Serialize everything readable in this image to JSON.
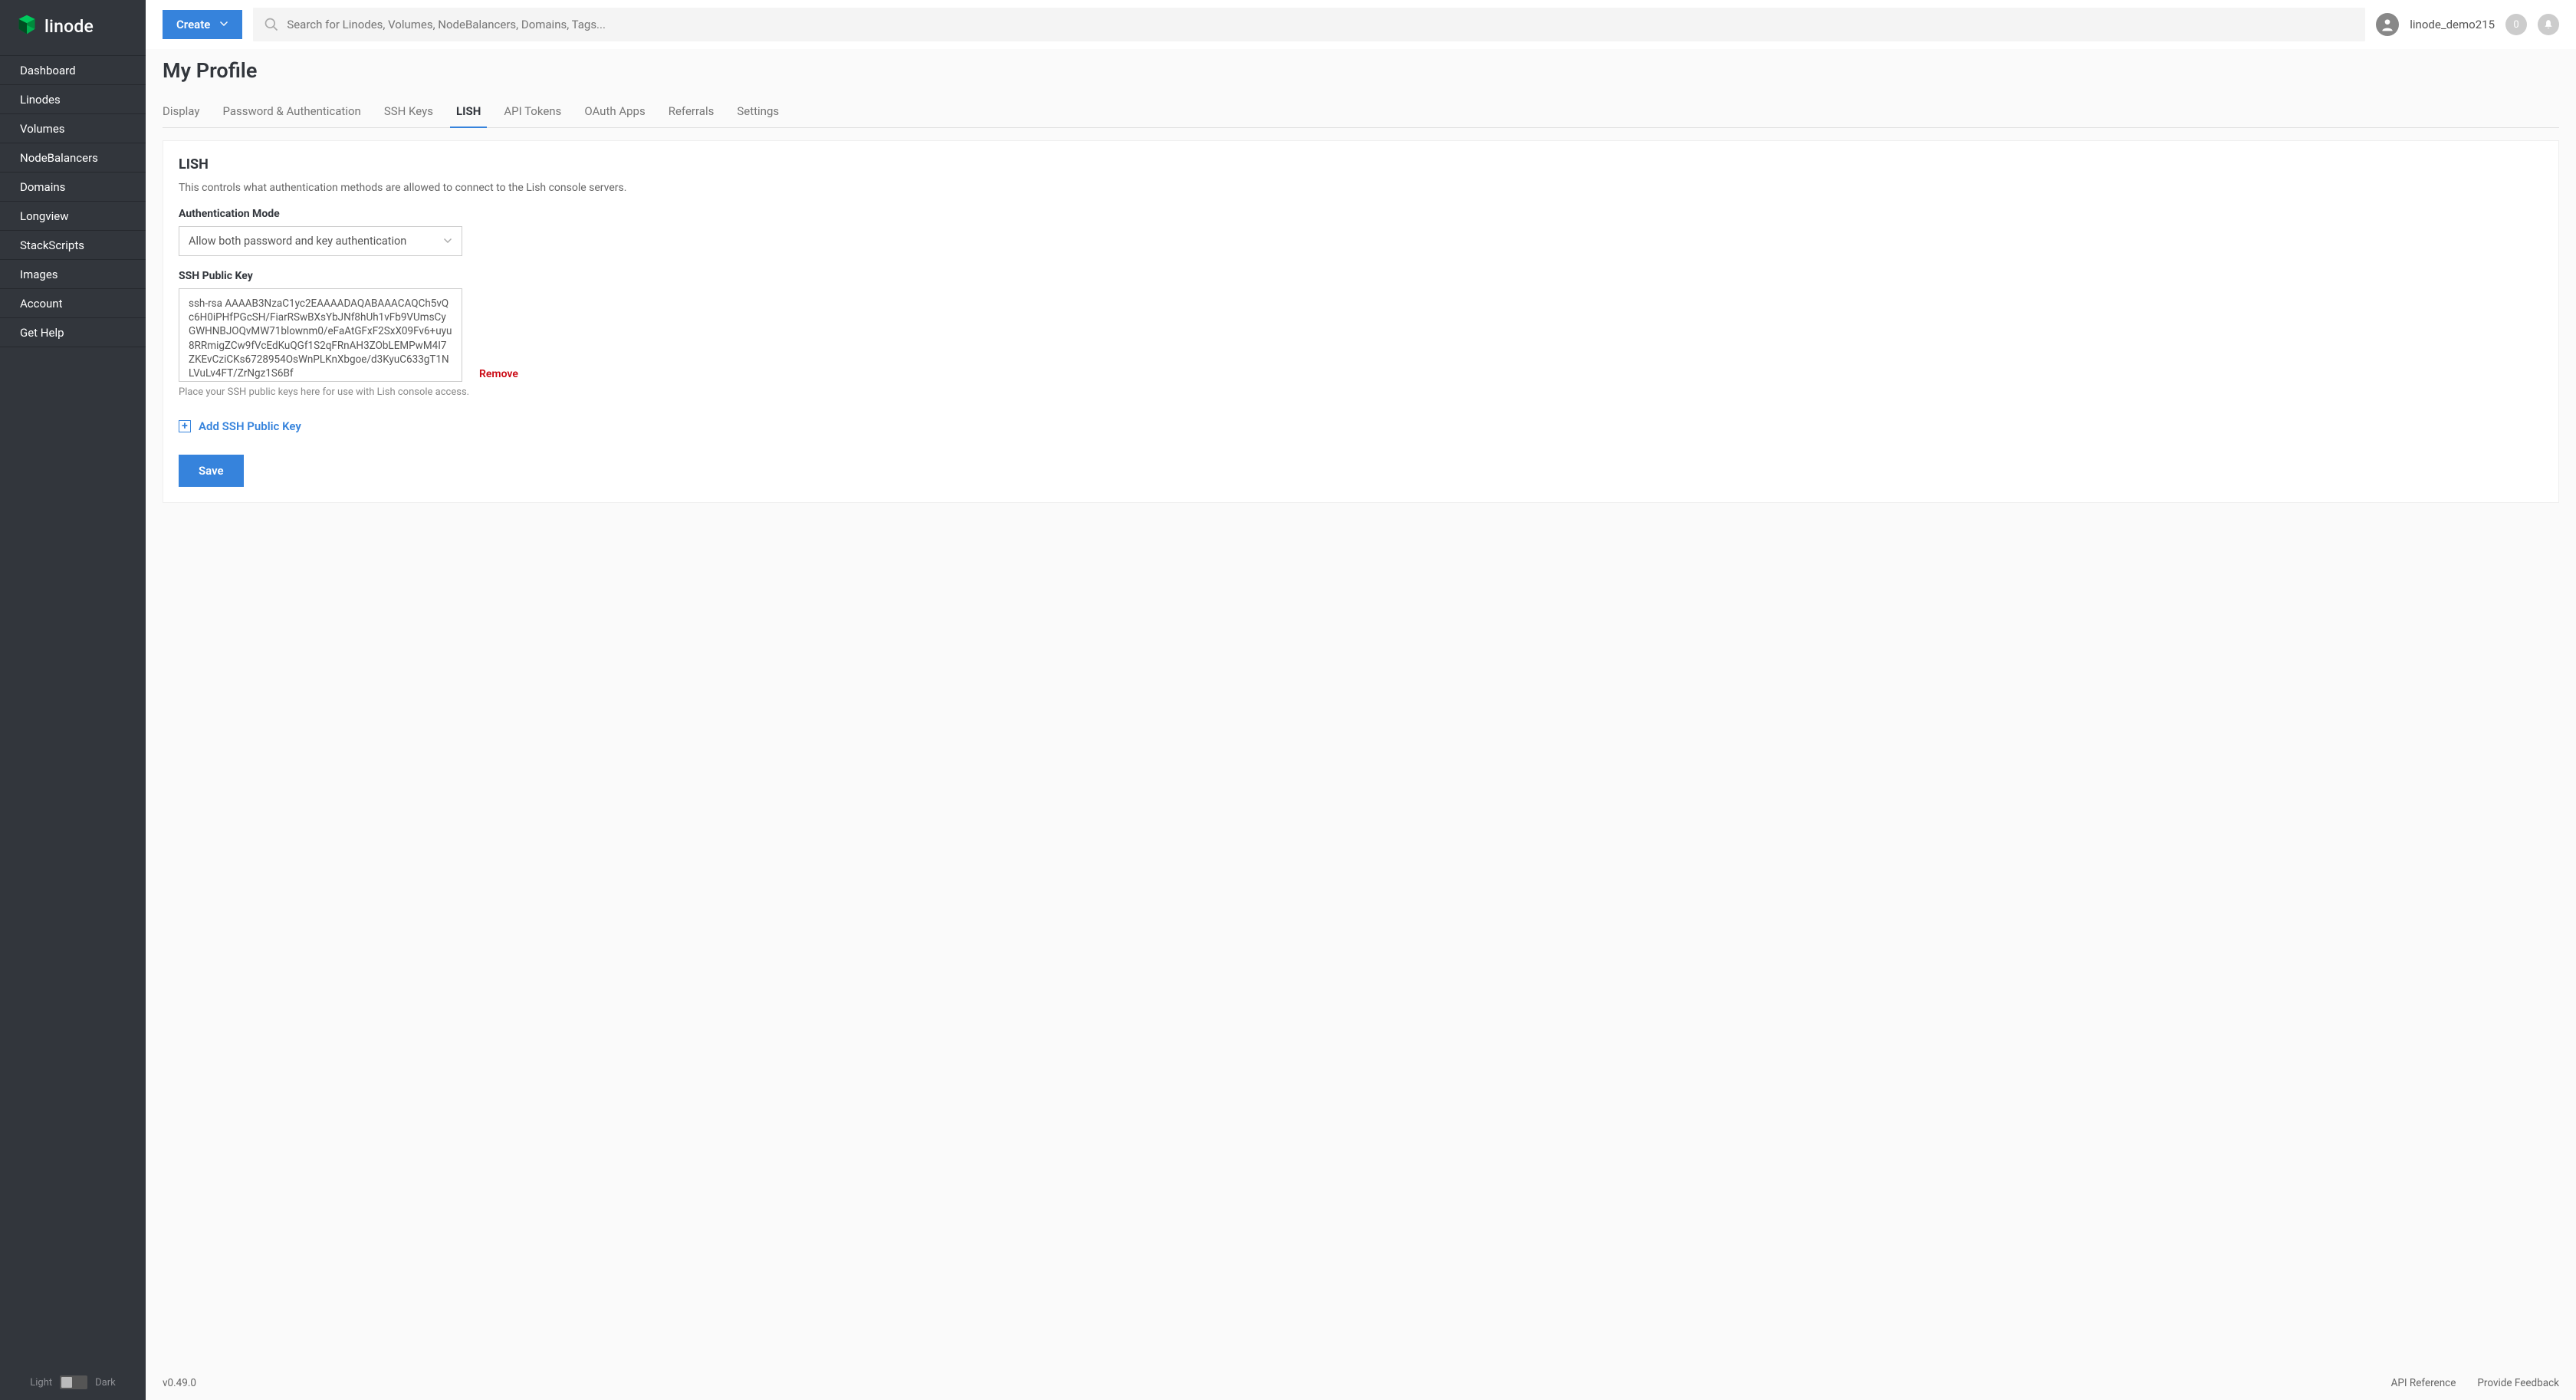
{
  "brand": "linode",
  "sidebar": {
    "items": [
      {
        "label": "Dashboard"
      },
      {
        "label": "Linodes"
      },
      {
        "label": "Volumes"
      },
      {
        "label": "NodeBalancers"
      },
      {
        "label": "Domains"
      },
      {
        "label": "Longview"
      },
      {
        "label": "StackScripts"
      },
      {
        "label": "Images"
      },
      {
        "label": "Account"
      },
      {
        "label": "Get Help"
      }
    ],
    "theme_light": "Light",
    "theme_dark": "Dark"
  },
  "header": {
    "create_label": "Create",
    "search_placeholder": "Search for Linodes, Volumes, NodeBalancers, Domains, Tags...",
    "username": "linode_demo215",
    "badge_count": "0"
  },
  "page": {
    "title": "My Profile",
    "tabs": [
      {
        "label": "Display"
      },
      {
        "label": "Password & Authentication"
      },
      {
        "label": "SSH Keys"
      },
      {
        "label": "LISH",
        "active": true
      },
      {
        "label": "API Tokens"
      },
      {
        "label": "OAuth Apps"
      },
      {
        "label": "Referrals"
      },
      {
        "label": "Settings"
      }
    ]
  },
  "lish": {
    "heading": "LISH",
    "description": "This controls what authentication methods are allowed to connect to the Lish console servers.",
    "auth_mode_label": "Authentication Mode",
    "auth_mode_value": "Allow both password and key authentication",
    "ssh_key_label": "SSH Public Key",
    "ssh_key_value": "ssh-rsa AAAAB3NzaC1yc2EAAAADAQABAAACAQCh5vQc6H0iPHfPGcSH/FiarRSwBXsYbJNf8hUh1vFb9VUmsCyGWHNBJOQvMW71blownm0/eFaAtGFxF2SxX09Fv6+uyu8RRmigZCw9fVcEdKuQGf1S2qFRnAH3ZObLEMPwM4I7ZKEvCziCKs6728954OsWnPLKnXbgoe/d3KyuC633gT1NLVuLv4FT/ZrNgz1S6Bf",
    "ssh_key_helper": "Place your SSH public keys here for use with Lish console access.",
    "remove_label": "Remove",
    "add_key_label": "Add SSH Public Key",
    "save_label": "Save"
  },
  "footer": {
    "version": "v0.49.0",
    "api_ref": "API Reference",
    "feedback": "Provide Feedback"
  }
}
